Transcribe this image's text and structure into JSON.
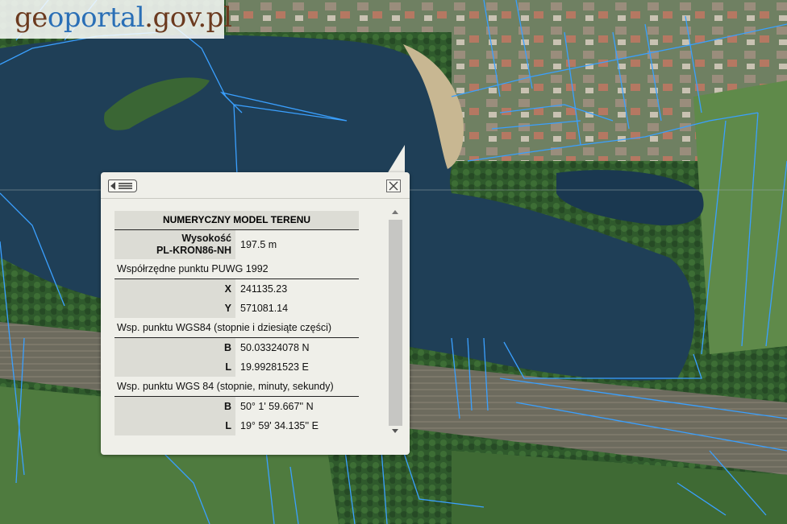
{
  "logo": {
    "part1": "ge",
    "part2": "oportal",
    "part3": ".gov.pl"
  },
  "icons": {
    "list": "list-icon",
    "close": "close-icon"
  },
  "colors": {
    "parcel_lines": "#3aa0ff",
    "water": "#1f3f57",
    "popup_bg": "#efefe9"
  },
  "popup": {
    "title": "NUMERYCZNY MODEL TERENU",
    "height": {
      "label_line1": "Wysokość",
      "label_line2": "PL-KRON86-NH",
      "value": "197.5 m"
    },
    "puwg": {
      "heading": "Współrzędne punktu PUWG 1992",
      "x_label": "X",
      "x_value": "241135.23",
      "y_label": "Y",
      "y_value": "571081.14"
    },
    "wgs_decimal": {
      "heading": "Wsp. punktu WGS84 (stopnie i dziesiąte części)",
      "b_label": "B",
      "b_value": "50.03324078 N",
      "l_label": "L",
      "l_value": "19.99281523 E"
    },
    "wgs_dms": {
      "heading": "Wsp. punktu WGS 84 (stopnie, minuty, sekundy)",
      "b_label": "B",
      "b_value": "50° 1' 59.667'' N",
      "l_label": "L",
      "l_value": "19° 59' 34.135'' E"
    }
  }
}
